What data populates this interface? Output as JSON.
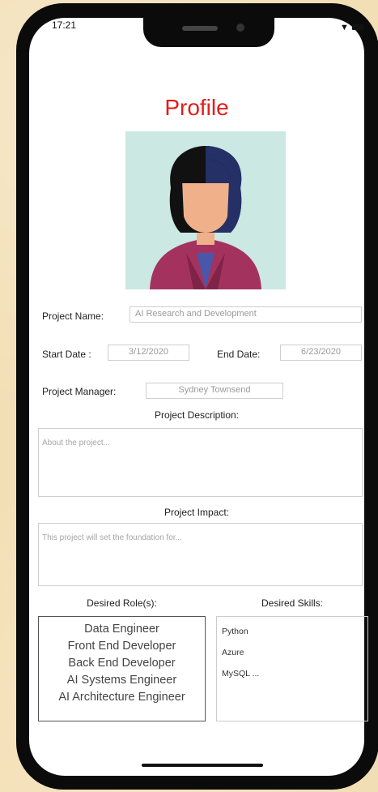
{
  "status": {
    "time": "17:21"
  },
  "title": "Profile",
  "project": {
    "name_label": "Project  Name:",
    "name_value": "AI Research and Development",
    "start_label": "Start Date :",
    "start_value": "3/12/2020",
    "end_label": "End Date:",
    "end_value": "6/23/2020",
    "manager_label": "Project Manager:",
    "manager_value": "Sydney Townsend",
    "description_label": "Project  Description:",
    "description_placeholder": "About the project...",
    "impact_label": "Project Impact:",
    "impact_placeholder": "This project will set the foundation for..."
  },
  "roles": {
    "label": "Desired Role(s):",
    "items": [
      "Data Engineer",
      "Front End Developer",
      "Back End Developer",
      "AI Systems Engineer",
      "AI Architecture Engineer"
    ]
  },
  "skills": {
    "label": "Desired Skills:",
    "items": [
      "Python",
      "Azure",
      "MySQL ..."
    ]
  },
  "colors": {
    "title": "#e11d1d",
    "avatar_bg": "#cbe8e3",
    "jacket": "#a3335e",
    "hair": "#1e2a5c"
  }
}
